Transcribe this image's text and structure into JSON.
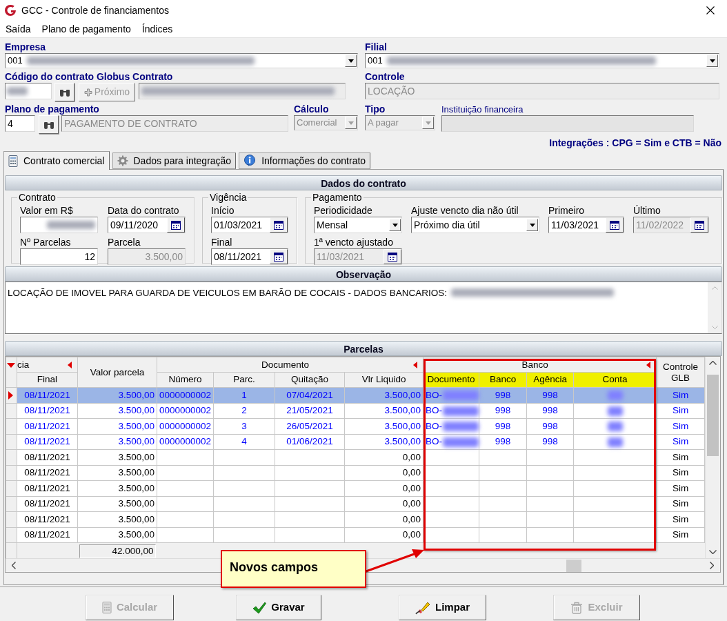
{
  "window": {
    "title": "GCC - Controle de financiamentos"
  },
  "menu": [
    {
      "label": "Saída"
    },
    {
      "label": "Plano de pagamento"
    },
    {
      "label": "Índices"
    }
  ],
  "empresa": {
    "label": "Empresa",
    "value": "001",
    "redacted": true
  },
  "filial": {
    "label": "Filial",
    "value": "001",
    "redacted": true
  },
  "contrato": {
    "label": "Código do contrato Globus Contrato",
    "redacted": true,
    "next_button": {
      "label": "Próximo",
      "disabled": true
    }
  },
  "controle": {
    "label": "Controle",
    "value": "LOCAÇÃO"
  },
  "plano": {
    "label": "Plano de pagamento",
    "code": "4",
    "description": "PAGAMENTO DE CONTRATO"
  },
  "calculo": {
    "label": "Cálculo",
    "value": "Comercial",
    "disabled": true
  },
  "tipo": {
    "label": "Tipo",
    "value": "A pagar",
    "disabled": true
  },
  "instituicao": {
    "label": "Instituição financeira"
  },
  "integracoes": "Integrações : CPG = Sim e CTB = Não",
  "tabs": [
    {
      "label": "Contrato comercial",
      "kind": "calculator",
      "selected": true
    },
    {
      "label": "Dados para integração",
      "kind": "gear",
      "selected": false
    },
    {
      "label": "Informações do contrato",
      "kind": "info",
      "selected": false
    }
  ],
  "dados": {
    "title": "Dados do contrato",
    "groups": [
      {
        "title": "Contrato",
        "fields": [
          {
            "label": "Valor em R$",
            "kind": "number",
            "disabled": false,
            "redacted": true
          },
          {
            "label": "Data do contrato",
            "kind": "date",
            "value": "09/11/2020",
            "disabled": false
          },
          {
            "label": "Nº Parcelas",
            "kind": "number",
            "value": "12",
            "disabled": false
          },
          {
            "label": "Parcela",
            "kind": "number",
            "value": "3.500,00",
            "disabled": true
          }
        ]
      },
      {
        "title": "Vigência",
        "fields": [
          {
            "label": "Início",
            "kind": "date",
            "value": "01/03/2021",
            "disabled": false
          },
          {
            "label": "Final",
            "kind": "date",
            "value": "08/11/2021",
            "disabled": false
          }
        ]
      },
      {
        "title": "Pagamento",
        "fields": [
          {
            "label": "Periodicidade",
            "kind": "combo",
            "value": "Mensal",
            "disabled": false
          },
          {
            "label": "Ajuste vencto dia não útil",
            "kind": "combo",
            "value": "Próximo dia útil",
            "disabled": false
          },
          {
            "label": "Primeiro",
            "kind": "date",
            "value": "11/03/2021",
            "disabled": false
          },
          {
            "label": "Último",
            "kind": "date",
            "value": "11/02/2022",
            "disabled": true
          },
          {
            "label": "1ª vencto ajustado",
            "kind": "date",
            "value": "11/03/2021",
            "disabled": true
          }
        ]
      }
    ]
  },
  "observacao": {
    "title": "Observação",
    "text": "LOCAÇÃO DE IMOVEL PARA GUARDA DE VEICULOS EM BARÃO DE COCAIS - DADOS BANCARIOS:",
    "redacted": true
  },
  "parcelas": {
    "title": "Parcelas",
    "column_groups": [
      {
        "label": "cia",
        "columns": [
          "Final"
        ],
        "sorted": true,
        "highlighted": false
      },
      {
        "label": "Valor parcela",
        "sorted": false,
        "highlighted": false
      },
      {
        "label": "Documento",
        "columns": [
          "Número",
          "Parc.",
          "Quitação",
          "Vlr Liquido"
        ],
        "sorted": true,
        "highlighted": false
      },
      {
        "label": "Banco",
        "columns": [
          "Documento",
          "Banco",
          "Agência",
          "Conta"
        ],
        "sorted": true,
        "highlighted": true
      },
      {
        "label": "Controle GLB",
        "sorted": false,
        "highlighted": false
      }
    ],
    "rows": [
      {
        "cells": [
          "08/11/2021",
          "3.500,00",
          "0000000002",
          "1",
          "07/04/2021",
          "3.500,00",
          "BO-",
          "998",
          "998",
          null,
          "Sim"
        ],
        "linked": true,
        "selected": true,
        "redacted": true
      },
      {
        "cells": [
          "08/11/2021",
          "3.500,00",
          "0000000002",
          "2",
          "21/05/2021",
          "3.500,00",
          "BO-",
          "998",
          "998",
          null,
          "Sim"
        ],
        "linked": true,
        "selected": false,
        "redacted": true
      },
      {
        "cells": [
          "08/11/2021",
          "3.500,00",
          "0000000002",
          "3",
          "26/05/2021",
          "3.500,00",
          "BO-",
          "998",
          "998",
          null,
          "Sim"
        ],
        "linked": true,
        "selected": false,
        "redacted": true
      },
      {
        "cells": [
          "08/11/2021",
          "3.500,00",
          "0000000002",
          "4",
          "01/06/2021",
          "3.500,00",
          "BO-",
          "998",
          "998",
          null,
          "Sim"
        ],
        "linked": true,
        "selected": false,
        "redacted": true
      },
      {
        "cells": [
          "08/11/2021",
          "3.500,00",
          null,
          null,
          null,
          "0,00",
          null,
          null,
          null,
          null,
          "Sim"
        ],
        "linked": false,
        "selected": false,
        "redacted": false
      },
      {
        "cells": [
          "08/11/2021",
          "3.500,00",
          null,
          null,
          null,
          "0,00",
          null,
          null,
          null,
          null,
          "Sim"
        ],
        "linked": false,
        "selected": false,
        "redacted": false
      },
      {
        "cells": [
          "08/11/2021",
          "3.500,00",
          null,
          null,
          null,
          "0,00",
          null,
          null,
          null,
          null,
          "Sim"
        ],
        "linked": false,
        "selected": false,
        "redacted": false
      },
      {
        "cells": [
          "08/11/2021",
          "3.500,00",
          null,
          null,
          null,
          "0,00",
          null,
          null,
          null,
          null,
          "Sim"
        ],
        "linked": false,
        "selected": false,
        "redacted": false
      },
      {
        "cells": [
          "08/11/2021",
          "3.500,00",
          null,
          null,
          null,
          "0,00",
          null,
          null,
          null,
          null,
          "Sim"
        ],
        "linked": false,
        "selected": false,
        "redacted": false
      },
      {
        "cells": [
          "08/11/2021",
          "3.500,00",
          null,
          null,
          null,
          "0,00",
          null,
          null,
          null,
          null,
          "Sim"
        ],
        "linked": false,
        "selected": false,
        "redacted": false
      }
    ],
    "totals": {
      "valor_parcela": "42.000,00"
    }
  },
  "annotation": {
    "text": "Novos campos"
  },
  "buttons": [
    {
      "label": "Calcular",
      "kind": "calculator",
      "disabled": true
    },
    {
      "label": "Gravar",
      "kind": "check",
      "disabled": false
    },
    {
      "label": "Limpar",
      "kind": "eraser",
      "disabled": false
    },
    {
      "label": "Excluir",
      "kind": "trash",
      "disabled": true
    }
  ]
}
